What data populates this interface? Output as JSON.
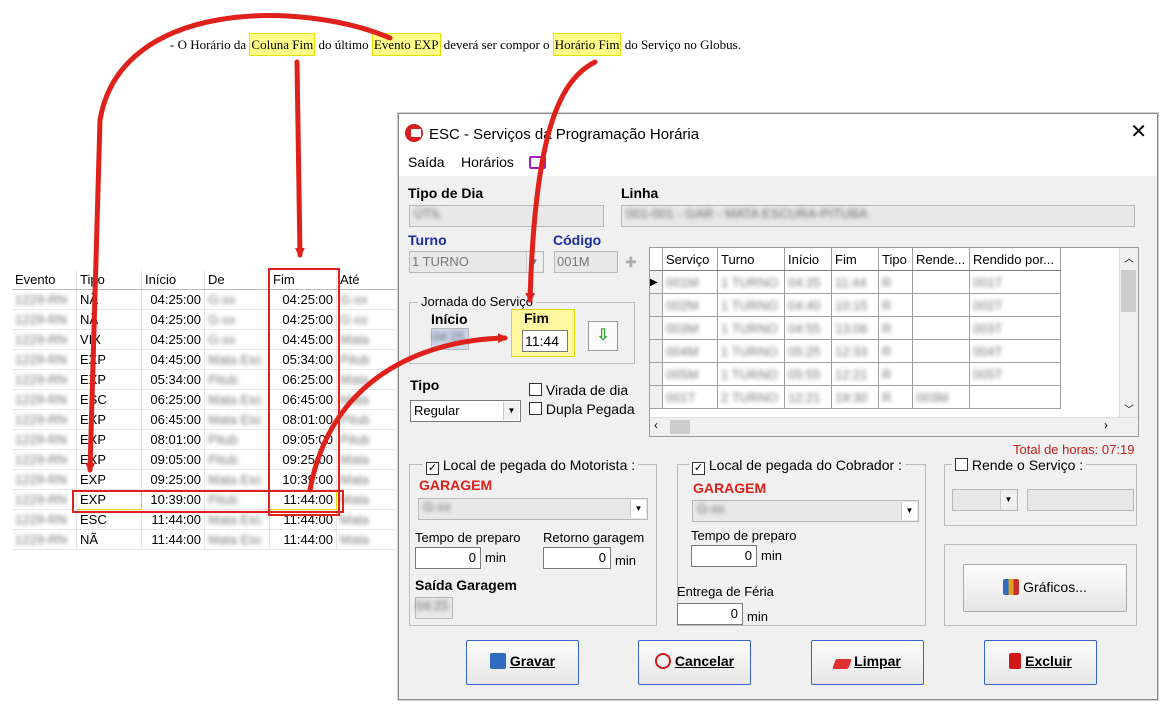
{
  "note": {
    "p1": "- O Horário da ",
    "h1": "Coluna Fim",
    "p2": " do último ",
    "h2": "Evento EXP",
    "p3": " deverá ser compor o ",
    "h3": "Horário Fim",
    "p4": " do Serviço no Globus."
  },
  "sheet": {
    "headers": [
      "Evento",
      "Tipo",
      "Início",
      "De",
      "Fim",
      "Até"
    ],
    "rows": [
      {
        "tipo": "NÃ",
        "inicio": "04:25:00",
        "fim": "04:25:00"
      },
      {
        "tipo": "NÃ",
        "inicio": "04:25:00",
        "fim": "04:25:00"
      },
      {
        "tipo": "VIX",
        "inicio": "04:25:00",
        "fim": "04:45:00"
      },
      {
        "tipo": "EXP",
        "inicio": "04:45:00",
        "fim": "05:34:00"
      },
      {
        "tipo": "EXP",
        "inicio": "05:34:00",
        "fim": "06:25:00"
      },
      {
        "tipo": "ESC",
        "inicio": "06:25:00",
        "fim": "06:45:00"
      },
      {
        "tipo": "EXP",
        "inicio": "06:45:00",
        "fim": "08:01:00"
      },
      {
        "tipo": "EXP",
        "inicio": "08:01:00",
        "fim": "09:05:00"
      },
      {
        "tipo": "EXP",
        "inicio": "09:05:00",
        "fim": "09:25:00"
      },
      {
        "tipo": "EXP",
        "inicio": "09:25:00",
        "fim": "10:39:00"
      },
      {
        "tipo": "EXP",
        "inicio": "10:39:00",
        "fim": "11:44:00"
      },
      {
        "tipo": "ESC",
        "inicio": "11:44:00",
        "fim": "11:44:00"
      },
      {
        "tipo": "NÃ",
        "inicio": "11:44:00",
        "fim": "11:44:00"
      }
    ]
  },
  "dialog": {
    "title": "ESC - Serviços da Programação Horária",
    "menu": {
      "saida": "Saída",
      "horarios": "Horários"
    },
    "tipo_dia_label": "Tipo de Dia",
    "linha_label": "Linha",
    "turno_label": "Turno",
    "turno_value": "1 TURNO",
    "codigo_label": "Código",
    "codigo_value": "001M",
    "jornada_label": "Jornada do Serviço",
    "inicio_label": "Início",
    "fim_label": "Fim",
    "fim_value": "11:44",
    "tipo_label": "Tipo",
    "tipo_value": "Regular",
    "virada_label": "Virada de dia",
    "dupla_label": "Dupla Pegada",
    "grid_headers": [
      "Serviço",
      "Turno",
      "Início",
      "Fim",
      "Tipo",
      "Rende...",
      "Rendido por..."
    ],
    "total_horas": "Total de horas: 07:19",
    "local_motorista": "Local de pegada do Motorista :",
    "garagem_motorista": "GARAGEM",
    "tempo_preparo_label": "Tempo de preparo",
    "tempo_preparo_value": "0",
    "retorno_label": "Retorno garagem",
    "retorno_value": "0",
    "min": "min",
    "saida_garagem_label": "Saída Garagem",
    "local_cobrador": "Local de pegada do Cobrador :",
    "garagem_cobrador": "GARAGEM",
    "tempo_preparo2_label": "Tempo de preparo",
    "tempo_preparo2_value": "0",
    "entrega_label": "Entrega de Féria",
    "entrega_value": "0",
    "rende_label": "Rende o Serviço :",
    "graficos_label": "Gráficos...",
    "buttons": {
      "gravar": "Gravar",
      "cancelar": "Cancelar",
      "limpar": "Limpar",
      "excluir": "Excluir"
    }
  },
  "colors": {
    "accent_red": "#e0201a",
    "highlight": "#fff8a0",
    "label_blue": "#1a2f9a"
  }
}
